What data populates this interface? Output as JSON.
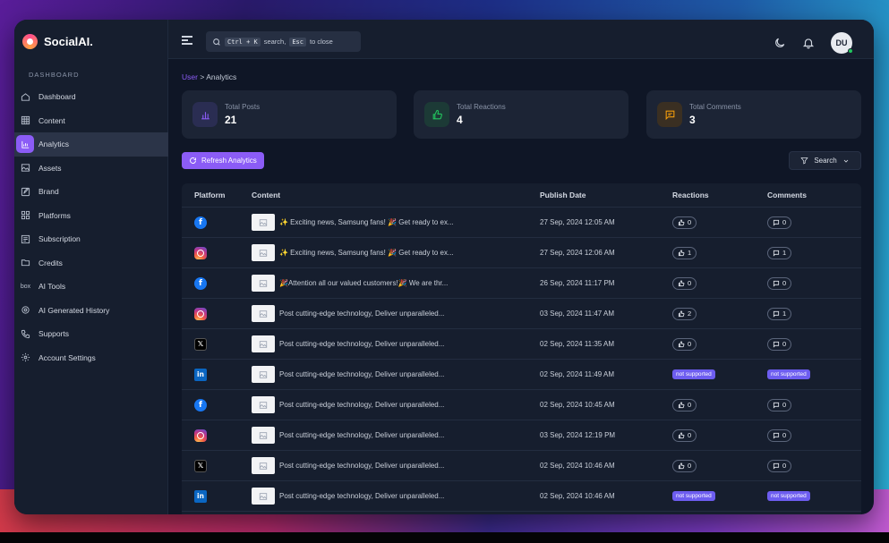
{
  "app": {
    "name": "SocialAI."
  },
  "sidebar": {
    "section": "DASHBOARD",
    "items": [
      {
        "label": "Dashboard",
        "icon": "home-icon",
        "active": false
      },
      {
        "label": "Content",
        "icon": "grid-icon",
        "active": false
      },
      {
        "label": "Analytics",
        "icon": "chart-icon",
        "active": true
      },
      {
        "label": "Assets",
        "icon": "image-icon",
        "active": false
      },
      {
        "label": "Brand",
        "icon": "edit-icon",
        "active": false
      },
      {
        "label": "Platforms",
        "icon": "apps-icon",
        "active": false
      },
      {
        "label": "Subscription",
        "icon": "list-icon",
        "active": false
      },
      {
        "label": "Credits",
        "icon": "folder-icon",
        "active": false
      },
      {
        "label": "AI Tools",
        "icon": "box-icon",
        "active": false
      },
      {
        "label": "AI Generated History",
        "icon": "ai-icon",
        "active": false
      },
      {
        "label": "Supports",
        "icon": "phone-icon",
        "active": false
      },
      {
        "label": "Account Settings",
        "icon": "gear-icon",
        "active": false
      }
    ],
    "ai_tools_icon_text": "box"
  },
  "topbar": {
    "search_k1": "Ctrl + K",
    "search_mid": "search,",
    "search_k2": "Esc",
    "search_end": "to close",
    "avatar": "DU"
  },
  "breadcrumb": {
    "parent": "User",
    "sep": ">",
    "current": "Analytics"
  },
  "stats": [
    {
      "label": "Total Posts",
      "value": "21",
      "color": "#8b5cf6"
    },
    {
      "label": "Total Reactions",
      "value": "4",
      "color": "#22c55e"
    },
    {
      "label": "Total Comments",
      "value": "3",
      "color": "#f59e0b"
    }
  ],
  "actions": {
    "refresh": "Refresh Analytics",
    "search": "Search"
  },
  "table": {
    "headers": [
      "Platform",
      "Content",
      "Publish Date",
      "Reactions",
      "Comments"
    ],
    "not_supported": "not supported",
    "rows": [
      {
        "platform": "facebook",
        "content": "✨ Exciting news, Samsung fans! 🎉 Get ready to ex...",
        "date": "27 Sep, 2024 12:05 AM",
        "reactions": "0",
        "comments": "0"
      },
      {
        "platform": "instagram",
        "content": "✨ Exciting news, Samsung fans! 🎉 Get ready to ex...",
        "date": "27 Sep, 2024 12:06 AM",
        "reactions": "1",
        "comments": "1"
      },
      {
        "platform": "facebook",
        "content": "🎉Attention all our valued customers!🎉 We are thr...",
        "date": "26 Sep, 2024 11:17 PM",
        "reactions": "0",
        "comments": "0"
      },
      {
        "platform": "instagram",
        "content": "Post cutting-edge technology, Deliver unparalleled...",
        "date": "03 Sep, 2024 11:47 AM",
        "reactions": "2",
        "comments": "1"
      },
      {
        "platform": "x",
        "content": "Post cutting-edge technology, Deliver unparalleled...",
        "date": "02 Sep, 2024 11:35 AM",
        "reactions": "0",
        "comments": "0"
      },
      {
        "platform": "linkedin",
        "content": "Post cutting-edge technology, Deliver unparalleled...",
        "date": "02 Sep, 2024 11:49 AM",
        "reactions": null,
        "comments": null
      },
      {
        "platform": "facebook",
        "content": "Post cutting-edge technology, Deliver unparalleled...",
        "date": "02 Sep, 2024 10:45 AM",
        "reactions": "0",
        "comments": "0"
      },
      {
        "platform": "instagram",
        "content": "Post cutting-edge technology, Deliver unparalleled...",
        "date": "03 Sep, 2024 12:19 PM",
        "reactions": "0",
        "comments": "0"
      },
      {
        "platform": "x",
        "content": "Post cutting-edge technology, Deliver unparalleled...",
        "date": "02 Sep, 2024 10:46 AM",
        "reactions": "0",
        "comments": "0"
      },
      {
        "platform": "linkedin",
        "content": "Post cutting-edge technology, Deliver unparalleled...",
        "date": "02 Sep, 2024 10:46 AM",
        "reactions": null,
        "comments": null
      }
    ]
  }
}
